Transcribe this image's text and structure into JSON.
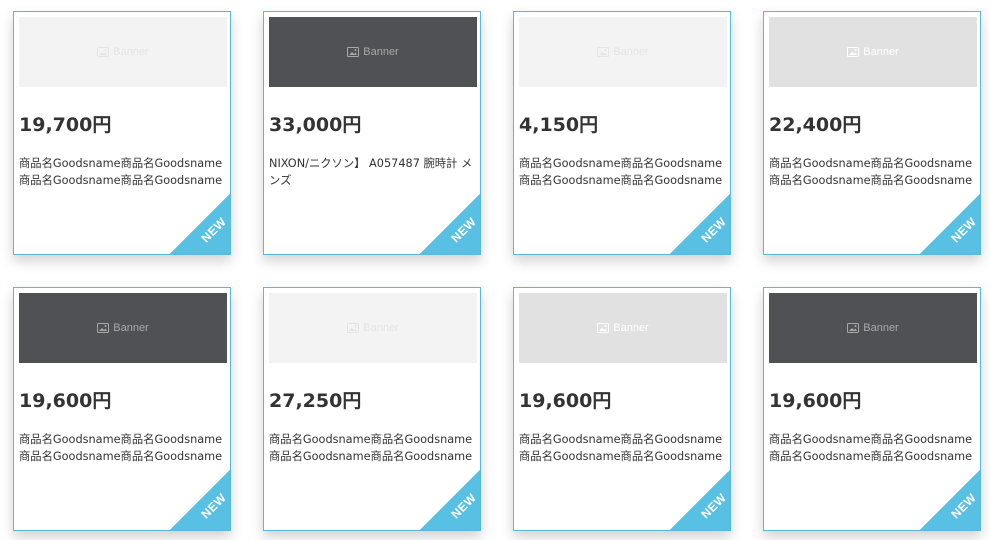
{
  "products": [
    {
      "banner_label": "Banner",
      "banner_tone": "light",
      "price": "19,700円",
      "name": "商品名Goodsname商品名Goodsname商品名Goodsname商品名Goodsname",
      "badge": "NEW"
    },
    {
      "banner_label": "Banner",
      "banner_tone": "dark",
      "price": "33,000円",
      "name": "NIXON/ニクソン】 A057487 腕時計 メンズ",
      "badge": "NEW"
    },
    {
      "banner_label": "Banner",
      "banner_tone": "light",
      "price": "4,150円",
      "name": "商品名Goodsname商品名Goodsname商品名Goodsname商品名Goodsname",
      "badge": "NEW"
    },
    {
      "banner_label": "Banner",
      "banner_tone": "mid",
      "price": "22,400円",
      "name": "商品名Goodsname商品名Goodsname商品名Goodsname商品名Goodsname",
      "badge": "NEW"
    },
    {
      "banner_label": "Banner",
      "banner_tone": "dark",
      "price": "19,600円",
      "name": "商品名Goodsname商品名Goodsname商品名Goodsname商品名Goodsname",
      "badge": "NEW"
    },
    {
      "banner_label": "Banner",
      "banner_tone": "light",
      "price": "27,250円",
      "name": "商品名Goodsname商品名Goodsname商品名Goodsname商品名Goodsname",
      "badge": "NEW"
    },
    {
      "banner_label": "Banner",
      "banner_tone": "mid",
      "price": "19,600円",
      "name": "商品名Goodsname商品名Goodsname商品名Goodsname商品名Goodsname",
      "badge": "NEW"
    },
    {
      "banner_label": "Banner",
      "banner_tone": "dark",
      "price": "19,600円",
      "name": "商品名Goodsname商品名Goodsname商品名Goodsname商品名Goodsname",
      "badge": "NEW"
    }
  ],
  "colors": {
    "card_border": "#5ab8dc",
    "ribbon": "#58c0e2",
    "text": "#333333"
  },
  "icons": {
    "banner": "image-icon"
  }
}
